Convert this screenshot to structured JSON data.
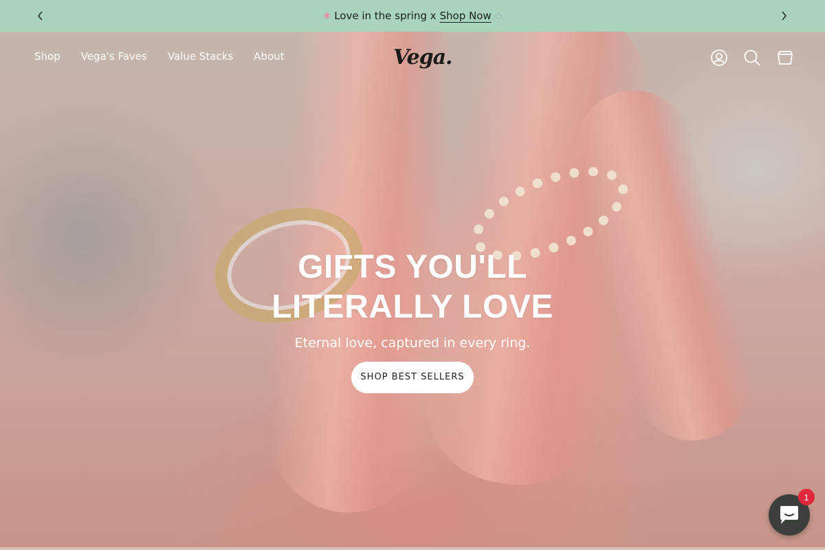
{
  "announcement": {
    "prefix_icon": "cherry-blossom-icon",
    "text": "Love in the spring x",
    "link": "Shop Now",
    "suffix_icon": "ring-icon",
    "prev_icon": "chevron-left-icon",
    "next_icon": "chevron-right-icon"
  },
  "header": {
    "nav": [
      "Shop",
      "Vega's Faves",
      "Value Stacks",
      "About"
    ],
    "logo": "Vega.",
    "icons": [
      "account-icon",
      "search-icon",
      "cart-icon"
    ]
  },
  "hero": {
    "title_line1": "GIFTS YOU'LL",
    "title_line2": "LITERALLY LOVE",
    "subtitle": "Eternal love, captured in every ring.",
    "cta": "SHOP BEST SELLERS"
  },
  "chat": {
    "icon": "chat-icon",
    "badge": "1"
  },
  "colors": {
    "announcement_bg": "#a9d5bd",
    "chat_bg": "#3c403b",
    "badge_bg": "#e0273b"
  }
}
